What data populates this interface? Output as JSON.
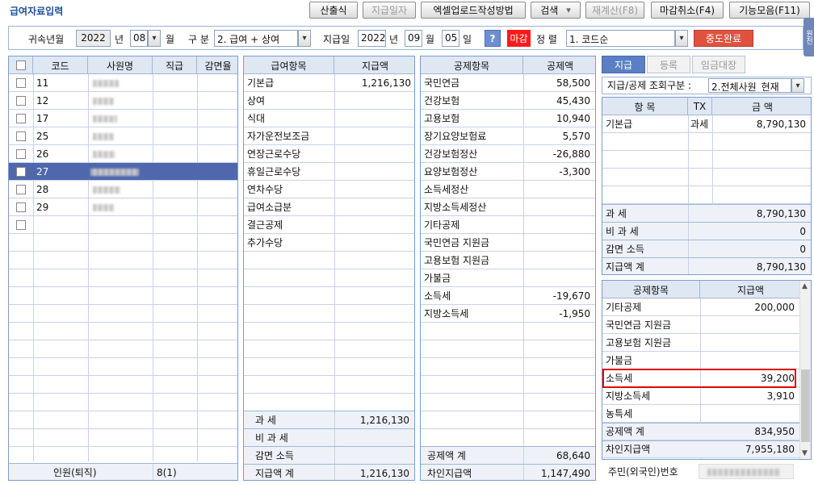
{
  "app": {
    "title": "급여자료입력"
  },
  "toolbar": {
    "calc": "산출식",
    "paydate": "지급일자",
    "excel": "엑셀업로드작성방법",
    "search": "검색",
    "recalc": "재계산(F8)",
    "close_cancel": "마감취소(F4)",
    "features": "기능모음(F11)"
  },
  "side_tab": "원천",
  "filter": {
    "belong_label": "귀속년월",
    "year": "2022",
    "year_unit": "년",
    "month": "08",
    "month_unit": "월",
    "type_label": "구 분",
    "type_value": "2. 급여 + 상여",
    "paydate_label": "지급일",
    "pay_year": "2022",
    "pay_month": "09",
    "pay_day": "05",
    "help": "?",
    "status": "마감",
    "sort_label": "정 렬",
    "sort_value": "1. 코드순",
    "done": "중도완료"
  },
  "employees": {
    "headers": [
      "코드",
      "사원명",
      "직급",
      "감면율"
    ],
    "rows": [
      {
        "code": "11"
      },
      {
        "code": "12"
      },
      {
        "code": "17"
      },
      {
        "code": "25"
      },
      {
        "code": "26"
      },
      {
        "code": "27"
      },
      {
        "code": "28"
      },
      {
        "code": "29"
      }
    ],
    "footer_label": "인원(퇴직)",
    "footer_value": "8(1)"
  },
  "pay_items": {
    "headers": [
      "급여항목",
      "지급액"
    ],
    "rows": [
      {
        "name": "기본급",
        "amount": "1,216,130"
      },
      {
        "name": "상여",
        "amount": ""
      },
      {
        "name": "식대",
        "amount": ""
      },
      {
        "name": "자가운전보조금",
        "amount": ""
      },
      {
        "name": "연장근로수당",
        "amount": ""
      },
      {
        "name": "휴일근로수당",
        "amount": ""
      },
      {
        "name": "연차수당",
        "amount": ""
      },
      {
        "name": "급여소급분",
        "amount": ""
      },
      {
        "name": "결근공제",
        "amount": ""
      },
      {
        "name": "추가수당",
        "amount": ""
      }
    ],
    "summary": [
      {
        "label": "과 세",
        "value": "1,216,130"
      },
      {
        "label": "비 과 세",
        "value": ""
      },
      {
        "label": "감면 소득",
        "value": ""
      },
      {
        "label": "지급액 계",
        "value": "1,216,130"
      }
    ]
  },
  "deductions": {
    "headers": [
      "공제항목",
      "공제액"
    ],
    "rows": [
      {
        "name": "국민연금",
        "amount": "58,500"
      },
      {
        "name": "건강보험",
        "amount": "45,430"
      },
      {
        "name": "고용보험",
        "amount": "10,940"
      },
      {
        "name": "장기요양보험료",
        "amount": "5,570"
      },
      {
        "name": "건강보험정산",
        "amount": "-26,880"
      },
      {
        "name": "요양보험정산",
        "amount": "-3,300"
      },
      {
        "name": "소득세정산",
        "amount": ""
      },
      {
        "name": "지방소득세정산",
        "amount": ""
      },
      {
        "name": "기타공제",
        "amount": ""
      },
      {
        "name": "국민연금 지원금",
        "amount": ""
      },
      {
        "name": "고용보험 지원금",
        "amount": ""
      },
      {
        "name": "가불금",
        "amount": ""
      },
      {
        "name": "소득세",
        "amount": "-19,670"
      },
      {
        "name": "지방소득세",
        "amount": "-1,950"
      }
    ],
    "summary": [
      {
        "label": "공제액 계",
        "value": "68,640"
      },
      {
        "label": "차인지급액",
        "value": "1,147,490"
      }
    ]
  },
  "right": {
    "tabs": [
      "지급",
      "등록",
      "임금대장"
    ],
    "query_label": "지급/공제 조회구분 :",
    "query_value": "2.전체사원_현재",
    "headers": [
      "항 목",
      "TX",
      "금 액"
    ],
    "rows": [
      {
        "name": "기본급",
        "tx": "과세",
        "amount": "8,790,130"
      }
    ],
    "summary": [
      {
        "label": "과 세",
        "value": "8,790,130"
      },
      {
        "label": "비 과 세",
        "value": "0"
      },
      {
        "label": "감면 소득",
        "value": "0"
      },
      {
        "label": "지급액 계",
        "value": "8,790,130"
      }
    ],
    "ded_headers": [
      "공제항목",
      "지급액"
    ],
    "ded_rows": [
      {
        "name": "기타공제",
        "amount": "200,000"
      },
      {
        "name": "국민연금 지원금",
        "amount": ""
      },
      {
        "name": "고용보험 지원금",
        "amount": ""
      },
      {
        "name": "가불금",
        "amount": ""
      },
      {
        "name": "소득세",
        "amount": "39,200"
      },
      {
        "name": "지방소득세",
        "amount": "3,910"
      },
      {
        "name": "농특세",
        "amount": ""
      },
      {
        "name": "공제액 계",
        "amount": "834,950"
      },
      {
        "name": "차인지급액",
        "amount": "7,955,180"
      }
    ],
    "resident_label": "주민(외국인)번호"
  }
}
